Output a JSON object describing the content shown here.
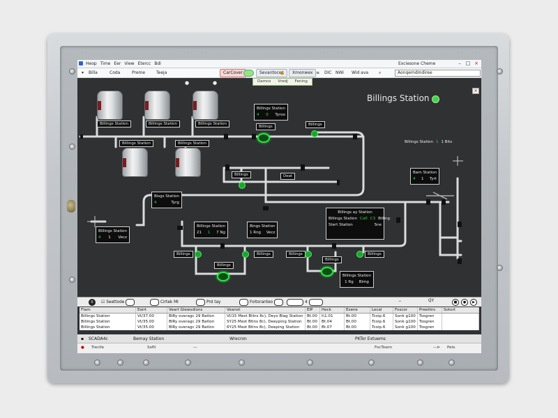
{
  "window": {
    "menu": [
      "Heop",
      "Time",
      "Eer",
      "View",
      "Etercc",
      "Bdi"
    ],
    "title": "Exciesone Cheme"
  },
  "ribbon": {
    "items": [
      "Billa",
      "Coda",
      "Preme",
      "Teeja"
    ],
    "button_primary": "CarCover",
    "button_secondary": "Sevantocez",
    "button_warning": "Xmonwex",
    "extra": [
      "DIC",
      "NWi",
      "Wid ava"
    ],
    "search_value": "Aonqemdmdiree"
  },
  "subtabs": [
    "Damco",
    "Vredj",
    "Fening"
  ],
  "overview": {
    "title": "Billings Station"
  },
  "tank_labels": [
    "Billings Station",
    "Billings Station",
    "Billings Station",
    "Billings Station",
    "Billings Station"
  ],
  "station_panels": {
    "top_center": {
      "title": "Billings Station",
      "v1": "4",
      "v2": "0",
      "v3": "Tyroo"
    },
    "pump1_label": "Billings",
    "right_top_label": "Billings",
    "far_right": {
      "title": "Billings Station",
      "v1": "1",
      "v2": "1 Bits"
    },
    "mid_left_label": "Billings",
    "mid_right_label": "Deat",
    "bsgs": {
      "title": "Bisgs Station",
      "v1": "4",
      "v2": "Tyrg"
    },
    "barn": {
      "title": "Barn Station",
      "v1": "4",
      "v2": "1",
      "v3": "Tyrt"
    },
    "left": {
      "title": "Billings Station",
      "v1": "4",
      "v2": "1",
      "v3": "Vecz"
    },
    "center": {
      "title": "Billings Station",
      "v1": "21",
      "v2": "1",
      "v3": "7 Ng"
    },
    "bings": {
      "title": "Bings Station",
      "v1": "1 Rng",
      "v2": "Vecz"
    },
    "big": {
      "title": "Billings ay Station",
      "r1a": "Billings Station",
      "r1b": "Ca0",
      "r1c": "C3",
      "r1d": "Billing",
      "r2a": "Stert Station",
      "r2b": "Sne"
    },
    "bottom_labels": [
      "Billings",
      "Billings",
      "Billings",
      "Billings",
      "Billings"
    ],
    "pump_bottom_label": "Billings",
    "pump_bottom2_label": "Billings",
    "bottom_right": {
      "title": "Billings Station",
      "v1": "1 Rg",
      "v2": "Bimg"
    }
  },
  "bottombar": {
    "items": [
      "Seettode",
      "Cirtek Ml",
      "Prd tay",
      "Foitoranteo"
    ],
    "num": "4",
    "right": "QY"
  },
  "table": {
    "headers": [
      "Flam",
      "Eairt",
      "Veart Glewsdions",
      "Veanot",
      "EIP",
      "Heck",
      "Esene",
      "Lecal",
      "Foscor",
      "Preeliinc",
      "Sotort"
    ],
    "rows": [
      [
        "Billings Station",
        "Vt/37.00",
        "BlRy overagc 29 Batlon",
        "VI/15 Mest Btlns 8c), Deys Blag Station",
        "Bt.00",
        "t\\1.01",
        "Bt.00",
        "Tcoip.6",
        "Sonk g100",
        "Tosgren",
        ""
      ],
      [
        "Billings Station",
        "Vt/35.00",
        "BlRy overagc 29 Batlon",
        "SY25 Mest Btlns 8c), Deeyping Station",
        "Bt.00",
        "Bt.04",
        "Bt.00",
        "Tcoip.6",
        "Sonk g100",
        "Tosgren",
        ""
      ],
      [
        "Billings Station",
        "Vt/35.00",
        "BlRy overagc 29 Batlon",
        "6Y25 Mest Btlns 8c), Deeping Station",
        "Bt.00",
        "Bt.07",
        "Bt.00",
        "Tcoip.6",
        "Sonk g100",
        "Tosgren",
        ""
      ]
    ]
  },
  "status": {
    "line1": [
      "SCADA4c",
      "Bemay Station",
      "Wrecron",
      "PKTor Extuems"
    ],
    "line2": [
      "Trecife",
      "Soflt",
      "—",
      "FocTowm",
      "Pets"
    ]
  },
  "colors": {
    "screen_bg": "#2f3133",
    "pipe": "#d9dcdc",
    "active_green": "#27e43e"
  }
}
